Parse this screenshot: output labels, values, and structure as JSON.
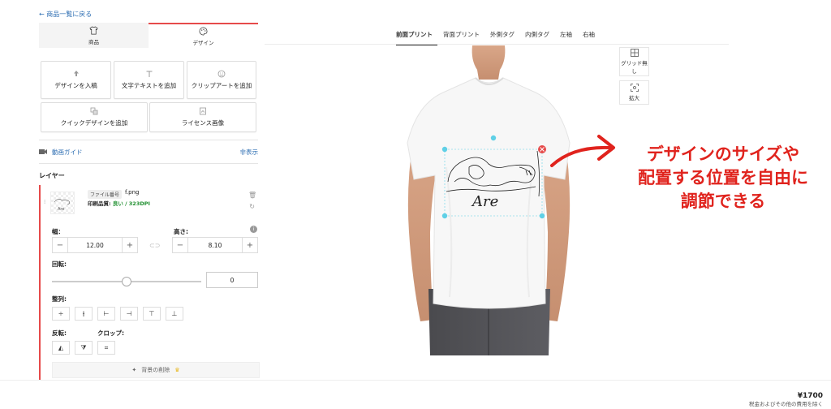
{
  "nav": {
    "back_label": "← 商品一覧に戻る"
  },
  "tabs": [
    {
      "label": "商品",
      "icon": "tshirt-icon"
    },
    {
      "label": "デザイン",
      "icon": "palette-icon"
    }
  ],
  "tools": {
    "upload": "デザインを入稿",
    "text": "文字テキストを追加",
    "clipart": "クリップアートを追加",
    "quick": "クイックデザインを追加",
    "license": "ライセンス画像"
  },
  "video_guide": {
    "label": "動画ガイド",
    "hide": "非表示"
  },
  "layer": {
    "title": "レイヤー",
    "file_tag": "ファイル番号",
    "file_name": "f.png",
    "quality_label": "印刷品質:",
    "quality_value": "良い / 323DPI",
    "width_label": "幅：",
    "width_value": "12.00",
    "height_label": "高さ:",
    "height_value": "8.10",
    "rotation_label": "回転:",
    "rotation_value": "0",
    "rotation_fraction": 0.5,
    "align_label": "整列:",
    "flip_label": "反転:",
    "crop_label": "クロップ:",
    "bg_remove": "背景の削除"
  },
  "print_tabs": [
    "前面プリント",
    "背面プリント",
    "外側タグ",
    "内側タグ",
    "左袖",
    "右袖"
  ],
  "side_buttons": {
    "grid": "グリッド無し",
    "zoom": "拡大"
  },
  "design_text": "Are",
  "annotation": [
    "デザインのサイズや",
    "配置する位置を自由に",
    "調節できる"
  ],
  "footer": {
    "price": "¥1700",
    "tax_note": "税金およびその他の費用を除く"
  },
  "colors": {
    "accent": "#e64a4a",
    "link": "#2f6fb3",
    "annotation": "#e0231d",
    "good": "#1f8f2f"
  }
}
